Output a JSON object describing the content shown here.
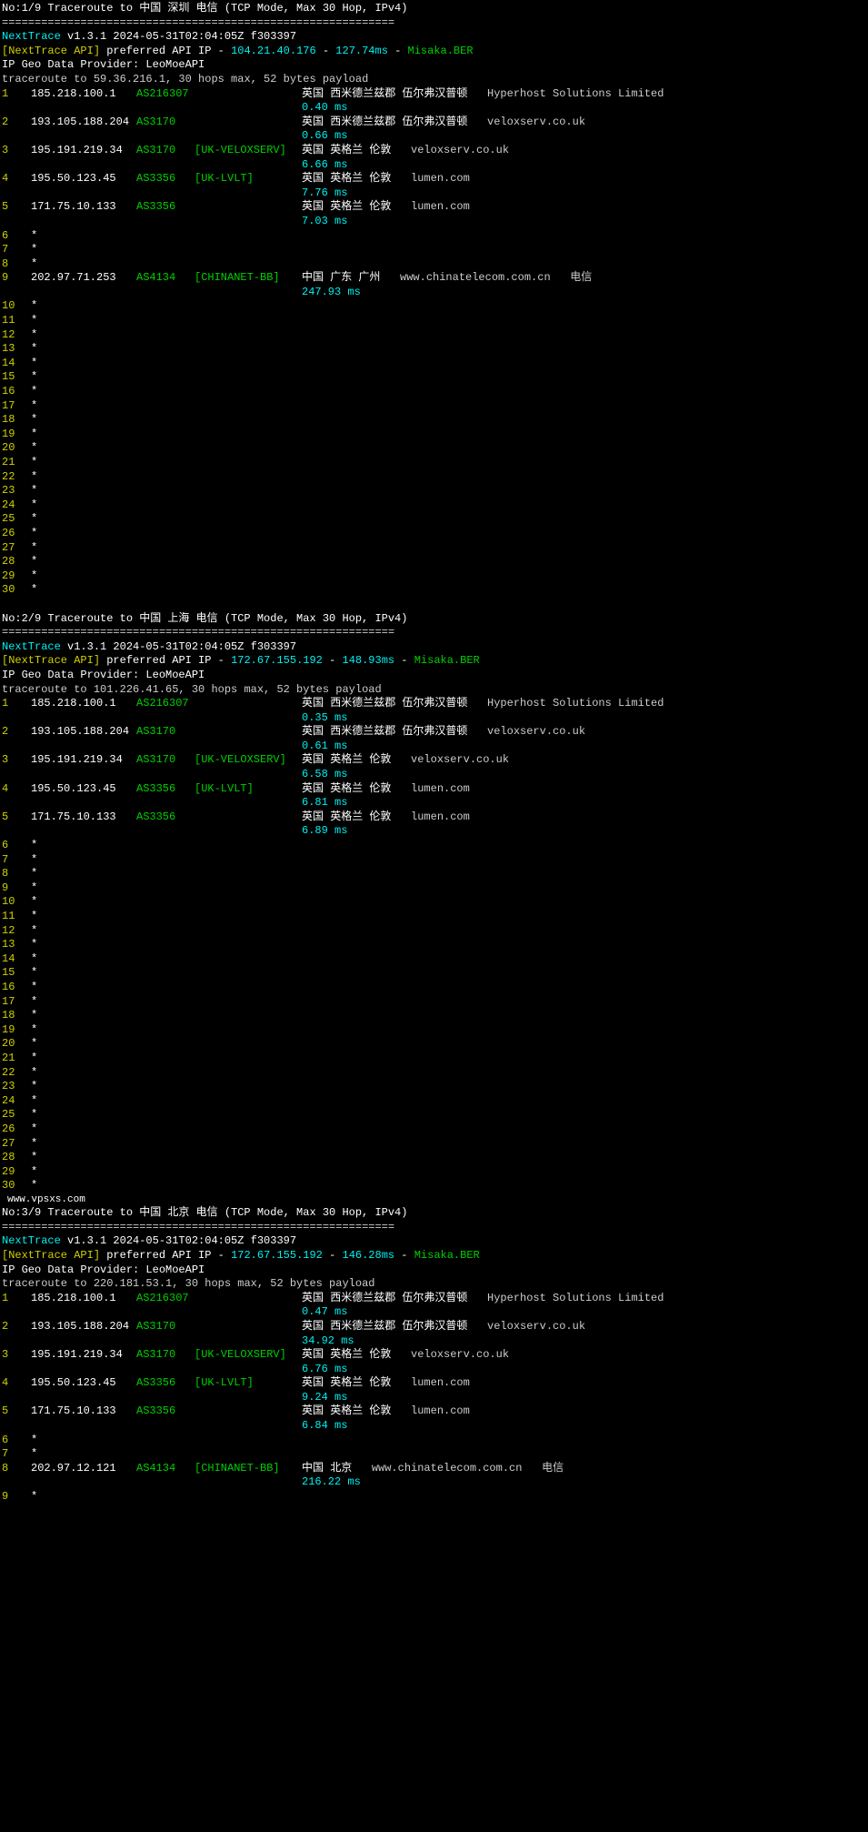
{
  "divider": "============================================================",
  "program": "NextTrace",
  "version": "v1.3.1 2024-05-31T02:04:05Z f303397",
  "apiLabel": "[NextTrace API]",
  "apiPreferred": "preferred API IP",
  "misaka": "Misaka.BER",
  "geoProvider": "IP Geo Data Provider: LeoMoeAPI",
  "watermark": "www.vpsxs.com",
  "traces": [
    {
      "title": "No:1/9 Traceroute to 中国 深圳 电信 (TCP Mode, Max 30 Hop, IPv4)",
      "apiIp": "104.21.40.176",
      "apiMs": "127.74ms",
      "routeLine": "traceroute to 59.36.216.1, 30 hops max, 52 bytes payload",
      "hops": [
        {
          "n": "1",
          "ip": "185.218.100.1",
          "asn": "AS216307",
          "tag": "",
          "loc": "英国 西米德兰兹郡 伍尔弗汉普顿",
          "host": "",
          "isp": "Hyperhost Solutions Limited",
          "ms": "0.40 ms"
        },
        {
          "n": "2",
          "ip": "193.105.188.204",
          "asn": "AS3170",
          "tag": "",
          "loc": "英国 西米德兰兹郡 伍尔弗汉普顿",
          "host": "",
          "isp": "veloxserv.co.uk",
          "ms": "0.66 ms"
        },
        {
          "n": "3",
          "ip": "195.191.219.34",
          "asn": "AS3170",
          "tag": "[UK-VELOXSERV]",
          "loc": "英国 英格兰 伦敦",
          "host": "",
          "isp": "veloxserv.co.uk",
          "ms": "6.66 ms"
        },
        {
          "n": "4",
          "ip": "195.50.123.45",
          "asn": "AS3356",
          "tag": "[UK-LVLT]",
          "loc": "英国 英格兰 伦敦",
          "host": "",
          "isp": "lumen.com",
          "ms": "7.76 ms"
        },
        {
          "n": "5",
          "ip": "171.75.10.133",
          "asn": "AS3356",
          "tag": "",
          "loc": "英国 英格兰 伦敦",
          "host": "",
          "isp": "lumen.com",
          "ms": "7.03 ms"
        },
        {
          "n": "6",
          "star": true
        },
        {
          "n": "7",
          "star": true
        },
        {
          "n": "8",
          "star": true
        },
        {
          "n": "9",
          "ip": "202.97.71.253",
          "asn": "AS4134",
          "tag": "[CHINANET-BB]",
          "loc": "中国 广东 广州",
          "host": "www.chinatelecom.com.cn",
          "isp": "电信",
          "ms": "247.93 ms"
        },
        {
          "n": "10",
          "star": true
        },
        {
          "n": "11",
          "star": true
        },
        {
          "n": "12",
          "star": true
        },
        {
          "n": "13",
          "star": true
        },
        {
          "n": "14",
          "star": true
        },
        {
          "n": "15",
          "star": true
        },
        {
          "n": "16",
          "star": true
        },
        {
          "n": "17",
          "star": true
        },
        {
          "n": "18",
          "star": true
        },
        {
          "n": "19",
          "star": true
        },
        {
          "n": "20",
          "star": true
        },
        {
          "n": "21",
          "star": true
        },
        {
          "n": "22",
          "star": true
        },
        {
          "n": "23",
          "star": true
        },
        {
          "n": "24",
          "star": true
        },
        {
          "n": "25",
          "star": true
        },
        {
          "n": "26",
          "star": true
        },
        {
          "n": "27",
          "star": true
        },
        {
          "n": "28",
          "star": true
        },
        {
          "n": "29",
          "star": true
        },
        {
          "n": "30",
          "star": true
        }
      ]
    },
    {
      "title": "No:2/9 Traceroute to 中国 上海 电信 (TCP Mode, Max 30 Hop, IPv4)",
      "apiIp": "172.67.155.192",
      "apiMs": "148.93ms",
      "routeLine": "traceroute to 101.226.41.65, 30 hops max, 52 bytes payload",
      "hops": [
        {
          "n": "1",
          "ip": "185.218.100.1",
          "asn": "AS216307",
          "tag": "",
          "loc": "英国 西米德兰兹郡 伍尔弗汉普顿",
          "host": "",
          "isp": "Hyperhost Solutions Limited",
          "ms": "0.35 ms"
        },
        {
          "n": "2",
          "ip": "193.105.188.204",
          "asn": "AS3170",
          "tag": "",
          "loc": "英国 西米德兰兹郡 伍尔弗汉普顿",
          "host": "",
          "isp": "veloxserv.co.uk",
          "ms": "0.61 ms"
        },
        {
          "n": "3",
          "ip": "195.191.219.34",
          "asn": "AS3170",
          "tag": "[UK-VELOXSERV]",
          "loc": "英国 英格兰 伦敦",
          "host": "",
          "isp": "veloxserv.co.uk",
          "ms": "6.58 ms"
        },
        {
          "n": "4",
          "ip": "195.50.123.45",
          "asn": "AS3356",
          "tag": "[UK-LVLT]",
          "loc": "英国 英格兰 伦敦",
          "host": "",
          "isp": "lumen.com",
          "ms": "6.81 ms"
        },
        {
          "n": "5",
          "ip": "171.75.10.133",
          "asn": "AS3356",
          "tag": "",
          "loc": "英国 英格兰 伦敦",
          "host": "",
          "isp": "lumen.com",
          "ms": "6.89 ms"
        },
        {
          "n": "6",
          "star": true
        },
        {
          "n": "7",
          "star": true
        },
        {
          "n": "8",
          "star": true
        },
        {
          "n": "9",
          "star": true
        },
        {
          "n": "10",
          "star": true
        },
        {
          "n": "11",
          "star": true
        },
        {
          "n": "12",
          "star": true
        },
        {
          "n": "13",
          "star": true
        },
        {
          "n": "14",
          "star": true
        },
        {
          "n": "15",
          "star": true
        },
        {
          "n": "16",
          "star": true
        },
        {
          "n": "17",
          "star": true
        },
        {
          "n": "18",
          "star": true
        },
        {
          "n": "19",
          "star": true
        },
        {
          "n": "20",
          "star": true
        },
        {
          "n": "21",
          "star": true
        },
        {
          "n": "22",
          "star": true
        },
        {
          "n": "23",
          "star": true
        },
        {
          "n": "24",
          "star": true
        },
        {
          "n": "25",
          "star": true
        },
        {
          "n": "26",
          "star": true
        },
        {
          "n": "27",
          "star": true
        },
        {
          "n": "28",
          "star": true
        },
        {
          "n": "29",
          "star": true
        },
        {
          "n": "30",
          "star": true
        }
      ]
    },
    {
      "title": "No:3/9 Traceroute to 中国 北京 电信 (TCP Mode, Max 30 Hop, IPv4)",
      "apiIp": "172.67.155.192",
      "apiMs": "146.28ms",
      "routeLine": "traceroute to 220.181.53.1, 30 hops max, 52 bytes payload",
      "hops": [
        {
          "n": "1",
          "ip": "185.218.100.1",
          "asn": "AS216307",
          "tag": "",
          "loc": "英国 西米德兰兹郡 伍尔弗汉普顿",
          "host": "",
          "isp": "Hyperhost Solutions Limited",
          "ms": "0.47 ms"
        },
        {
          "n": "2",
          "ip": "193.105.188.204",
          "asn": "AS3170",
          "tag": "",
          "loc": "英国 西米德兰兹郡 伍尔弗汉普顿",
          "host": "",
          "isp": "veloxserv.co.uk",
          "ms": "34.92 ms"
        },
        {
          "n": "3",
          "ip": "195.191.219.34",
          "asn": "AS3170",
          "tag": "[UK-VELOXSERV]",
          "loc": "英国 英格兰 伦敦",
          "host": "",
          "isp": "veloxserv.co.uk",
          "ms": "6.76 ms"
        },
        {
          "n": "4",
          "ip": "195.50.123.45",
          "asn": "AS3356",
          "tag": "[UK-LVLT]",
          "loc": "英国 英格兰 伦敦",
          "host": "",
          "isp": "lumen.com",
          "ms": "9.24 ms"
        },
        {
          "n": "5",
          "ip": "171.75.10.133",
          "asn": "AS3356",
          "tag": "",
          "loc": "英国 英格兰 伦敦",
          "host": "",
          "isp": "lumen.com",
          "ms": "6.84 ms"
        },
        {
          "n": "6",
          "star": true
        },
        {
          "n": "7",
          "star": true
        },
        {
          "n": "8",
          "ip": "202.97.12.121",
          "asn": "AS4134",
          "tag": "[CHINANET-BB]",
          "loc": "中国 北京",
          "host": "www.chinatelecom.com.cn",
          "isp": "电信",
          "ms": "216.22 ms"
        },
        {
          "n": "9",
          "star": true,
          "last": true
        }
      ]
    }
  ]
}
